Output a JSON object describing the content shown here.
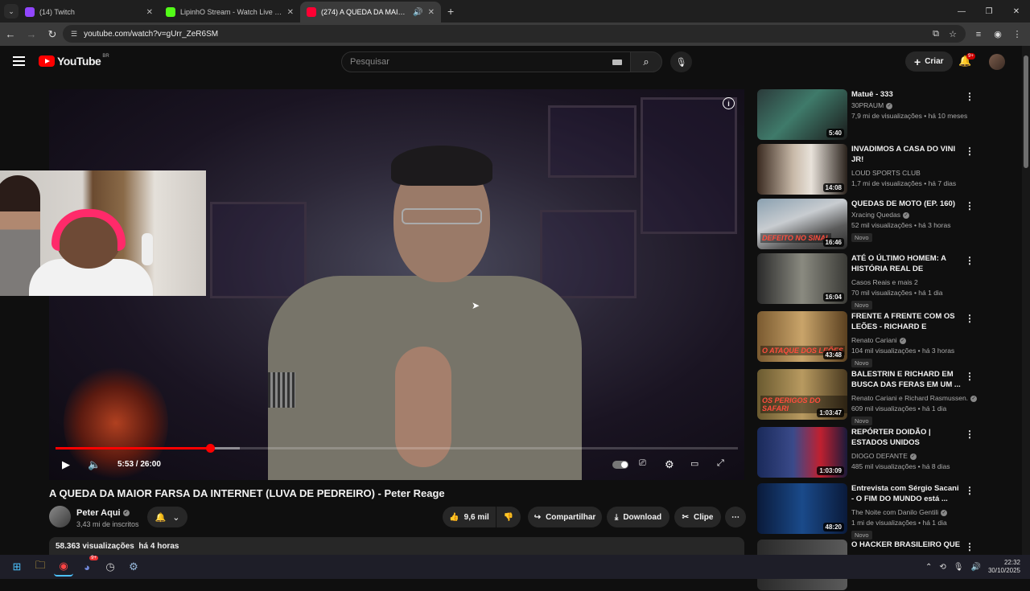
{
  "browser": {
    "tabs": [
      {
        "title": "(14) Twitch",
        "color": "#9146ff",
        "active": false,
        "audio": false
      },
      {
        "title": "LipinhO Stream - Watch Live on Kick",
        "color": "#53fc18",
        "active": false,
        "audio": false
      },
      {
        "title": "(274) A QUEDA DA MAIOR FARSA",
        "color": "#ff0033",
        "active": true,
        "audio": true
      }
    ],
    "url": "youtube.com/watch?v=gUrr_ZeR6SM"
  },
  "youtube": {
    "logo_text": "YouTube",
    "country_code": "BR",
    "search_placeholder": "Pesquisar",
    "create_label": "Criar",
    "notif_count": "9+"
  },
  "player": {
    "time": "5:53 / 26:00",
    "progress_fraction": 0.226,
    "buffer_fraction": 0.27
  },
  "video": {
    "title": "A QUEDA DA MAIOR FARSA DA INTERNET (LUVA DE PEDREIRO) - Peter Reage",
    "channel": "Peter Aqui",
    "subscribers": "3,43 mi de inscritos",
    "likes": "9,6 mil",
    "share_label": "Compartilhar",
    "download_label": "Download",
    "clip_label": "Clipe",
    "views": "58.363 visualizações",
    "age": "há 4 horas"
  },
  "sidebar": [
    {
      "title": "Matuê - 333",
      "channel": "30PRAUM",
      "verified": true,
      "meta": "7,9 mi de visualizações • há 10 meses",
      "duration": "5:40",
      "novo": false,
      "thumb": "linear-gradient(135deg,#2b3a3a,#3f7a6a 45%,#1a1a1a)",
      "label": ""
    },
    {
      "title": "INVADIMOS A CASA DO VINI JR!",
      "channel": "LOUD SPORTS CLUB",
      "verified": false,
      "meta": "1,7 mi de visualizações • há 7 dias",
      "duration": "14:08",
      "novo": false,
      "thumb": "linear-gradient(90deg,#3a2a20,#c8b9a8 40%,#e8e2da 60%,#2a221c)",
      "label": ""
    },
    {
      "title": "QUEDAS DE MOTO (EP. 160)",
      "channel": "Xracing Quedas",
      "verified": true,
      "meta": "52 mil visualizações • há 3 horas",
      "duration": "16:46",
      "novo": true,
      "thumb": "linear-gradient(160deg,#8aa0b0,#c8ccd0 40%,#5a5a5a 70%,#2a2a2a)",
      "label": "DEFEITO NO SINAL"
    },
    {
      "title": "ATÉ O ÚLTIMO HOMEM: A HISTÓRIA REAL DE DESMOND...",
      "channel": "Casos Reais e mais 2",
      "verified": false,
      "meta": "70 mil visualizações • há 1 dia",
      "duration": "16:04",
      "novo": true,
      "thumb": "linear-gradient(90deg,#2a2a2a,#8a8a80 50%,#3a3a36)",
      "label": ""
    },
    {
      "title": "FRENTE A FRENTE COM OS LEÕES - RICHARD E BALESTRI...",
      "channel": "Renato Cariani",
      "verified": true,
      "meta": "104 mil visualizações • há 3 horas",
      "duration": "43:48",
      "novo": true,
      "thumb": "linear-gradient(90deg,#7a5a30,#c9a46a 50%,#5a4020)",
      "label": "O ATAQUE DOS LEÕES"
    },
    {
      "title": "BALESTRIN E RICHARD EM BUSCA DAS FERAS EM UM ...",
      "channel": "Renato Cariani e Richard Rasmussen.",
      "verified": true,
      "meta": "609 mil visualizações • há 1 dia",
      "duration": "1:03:47",
      "novo": true,
      "thumb": "linear-gradient(90deg,#6a5a30,#b89a60 50%,#4a3a20)",
      "label": "OS PERIGOS DO SAFARI"
    },
    {
      "title": "REPÓRTER DOIDÃO | ESTADOS UNIDOS",
      "channel": "DIOGO DEFANTE",
      "verified": true,
      "meta": "485 mil visualizações • há 8 dias",
      "duration": "1:03:09",
      "novo": false,
      "thumb": "linear-gradient(90deg,#1a2a5a,#3a4a8a 40%,#c02030 70%,#1a1a3a)",
      "label": ""
    },
    {
      "title": "Entrevista com Sérgio Sacani - O FIM DO MUNDO está ...",
      "channel": "The Noite com Danilo Gentili",
      "verified": true,
      "meta": "1 mi de visualizações • há 1 dia",
      "duration": "48:20",
      "novo": true,
      "thumb": "linear-gradient(90deg,#0a1a3a,#1a4a8a 50%,#0a1a3a)",
      "label": ""
    },
    {
      "title": "O HACKER BRASILEIRO QUE",
      "channel": "",
      "verified": false,
      "meta": "",
      "duration": "",
      "novo": false,
      "thumb": "linear-gradient(90deg,#2a2a2a,#5a5a5a)",
      "label": ""
    }
  ],
  "taskbar": {
    "time": "22:32",
    "date": "30/10/2025",
    "discord_badge": "9+"
  }
}
